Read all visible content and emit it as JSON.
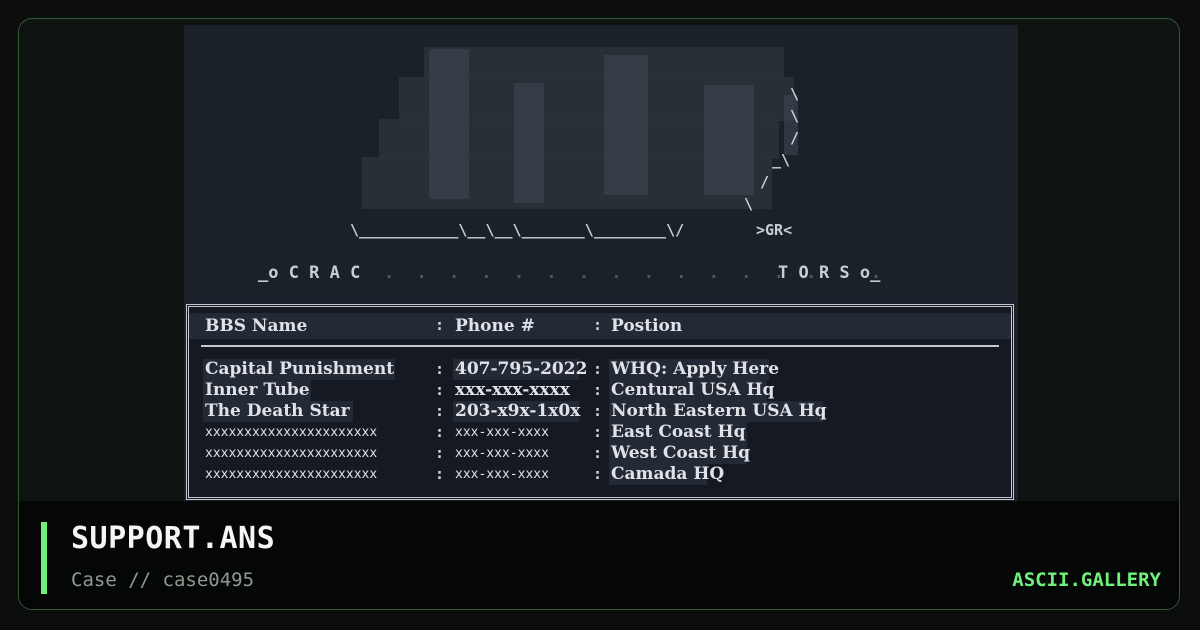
{
  "logo": {
    "signature": ">GR<",
    "banner_left": "_o C R A C",
    "banner_right": "T O R S o_",
    "base_line": "\\___________\\__\\__\\_______\\________\\/"
  },
  "table": {
    "headers": [
      "BBS Name",
      "Phone #",
      "Postion"
    ],
    "rows": [
      [
        "Capital Punishment",
        "407-795-2022",
        "WHQ: Apply Here"
      ],
      [
        "Inner Tube",
        "xxx-xxx-xxxx",
        "Centural USA Hq"
      ],
      [
        "The Death Star",
        "203-x9x-1x0x",
        "North Eastern USA Hq"
      ],
      [
        "xxxxxxxxxxxxxxxxxxxxxx",
        "xxx-xxx-xxxx",
        "East Coast Hq"
      ],
      [
        "xxxxxxxxxxxxxxxxxxxxxx",
        "xxx-xxx-xxxx",
        "West Coast Hq"
      ],
      [
        "xxxxxxxxxxxxxxxxxxxxxx",
        "xxx-xxx-xxxx",
        "Camada HQ"
      ]
    ]
  },
  "footer": {
    "title": "SUPPORT.ANS",
    "subtitle": "Case // case0495",
    "brand": "ASCII.GALLERY"
  },
  "colors": {
    "accent": "#6ff07a",
    "background": "#0b0e0d",
    "ansi_bg": "#1c222b"
  }
}
